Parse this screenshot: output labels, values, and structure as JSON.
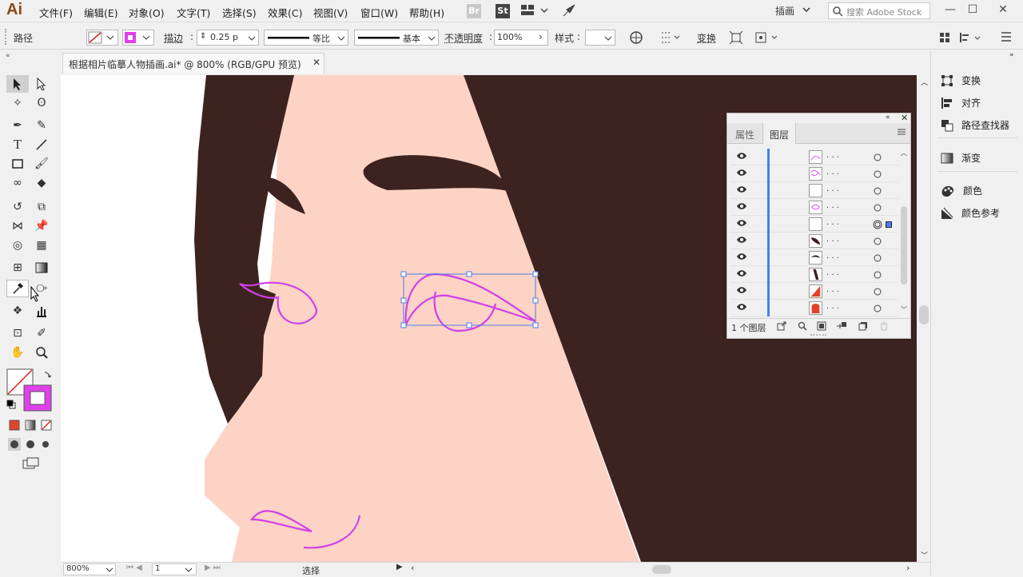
{
  "app": {
    "logo": "Ai"
  },
  "menu": [
    "文件(F)",
    "编辑(E)",
    "对象(O)",
    "文字(T)",
    "选择(S)",
    "效果(C)",
    "视图(V)",
    "窗口(W)",
    "帮助(H)"
  ],
  "badges": {
    "br": "Br",
    "st": "St"
  },
  "workspace": "插画",
  "search_placeholder": "搜索 Adobe Stock",
  "control": {
    "path_label": "路径",
    "stroke_label": "描边",
    "stroke_weight": "0.25 p",
    "profile1": "等比",
    "profile2": "基本",
    "opacity_label": "不透明度",
    "opacity_value": "100%",
    "style_label": "样式",
    "transform_label": "变换"
  },
  "document": {
    "tab_title": "根据相片临摹人物插画.ai* @ 800% (RGB/GPU 预览)"
  },
  "status": {
    "zoom": "800%",
    "artboard": "1",
    "tool": "选择"
  },
  "dock": [
    {
      "label": "变换",
      "icon": "transform-icon"
    },
    {
      "label": "对齐",
      "icon": "align-icon"
    },
    {
      "label": "路径查找器",
      "icon": "pathfinder-icon"
    },
    {
      "label": "渐变",
      "icon": "gradient-icon"
    },
    {
      "label": "颜色",
      "icon": "color-icon"
    },
    {
      "label": "颜色参考",
      "icon": "color-guide-icon"
    }
  ],
  "layers_panel": {
    "tabs": [
      "属性",
      "图层"
    ],
    "active_tab": "图层",
    "rows": [
      ". . .",
      ". . .",
      ". . .",
      ". . .",
      ". . .",
      ". . .",
      ". . .",
      ". . .",
      ". . .",
      ". . ."
    ],
    "count_label": "1 个图层"
  },
  "colors": {
    "hair": "#3d2320",
    "skin": "#fdd3c6",
    "path": "#d040e6",
    "selection": "#4a7ee8"
  }
}
